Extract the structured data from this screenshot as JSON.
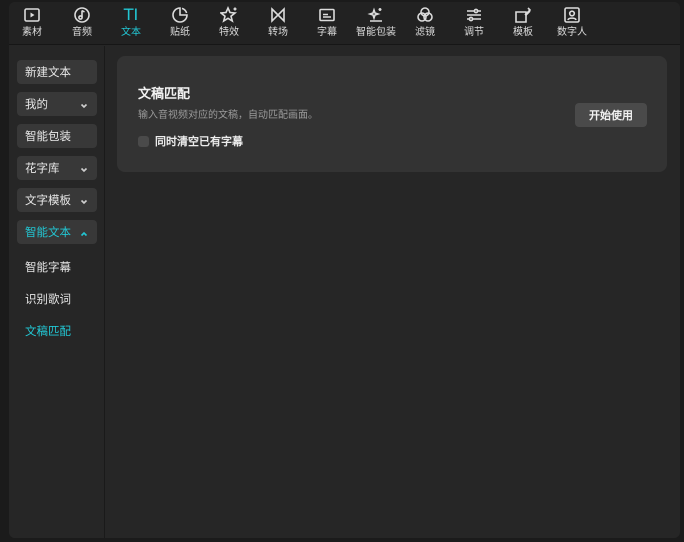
{
  "toolbar": {
    "tabs": [
      {
        "label": "素材",
        "icon": "media-play-icon"
      },
      {
        "label": "音频",
        "icon": "music-note-icon"
      },
      {
        "label": "文本",
        "icon": "text-icon",
        "glyph": "TI",
        "active": true
      },
      {
        "label": "贴纸",
        "icon": "sticker-icon"
      },
      {
        "label": "特效",
        "icon": "sparkle-star-icon"
      },
      {
        "label": "转场",
        "icon": "transition-icon"
      },
      {
        "label": "字幕",
        "icon": "subtitle-icon"
      },
      {
        "label": "智能包装",
        "icon": "smart-pack-icon"
      },
      {
        "label": "滤镜",
        "icon": "filter-icon"
      },
      {
        "label": "调节",
        "icon": "adjust-sliders-icon"
      },
      {
        "label": "模板",
        "icon": "template-icon"
      },
      {
        "label": "数字人",
        "icon": "digital-human-icon"
      }
    ]
  },
  "sidebar": {
    "items": [
      {
        "label": "新建文本"
      },
      {
        "label": "我的"
      },
      {
        "label": "智能包装"
      },
      {
        "label": "花字库"
      },
      {
        "label": "文字模板"
      },
      {
        "label": "智能文本"
      }
    ],
    "subitems": [
      {
        "label": "智能字幕"
      },
      {
        "label": "识别歌词"
      },
      {
        "label": "文稿匹配"
      }
    ]
  },
  "card": {
    "title": "文稿匹配",
    "description": "输入音视频对应的文稿，自动匹配画面。",
    "checkbox_label": "同时清空已有字幕",
    "start_button": "开始使用"
  },
  "colors": {
    "accent": "#22c7d4",
    "background": "#262626",
    "card": "#333333"
  }
}
